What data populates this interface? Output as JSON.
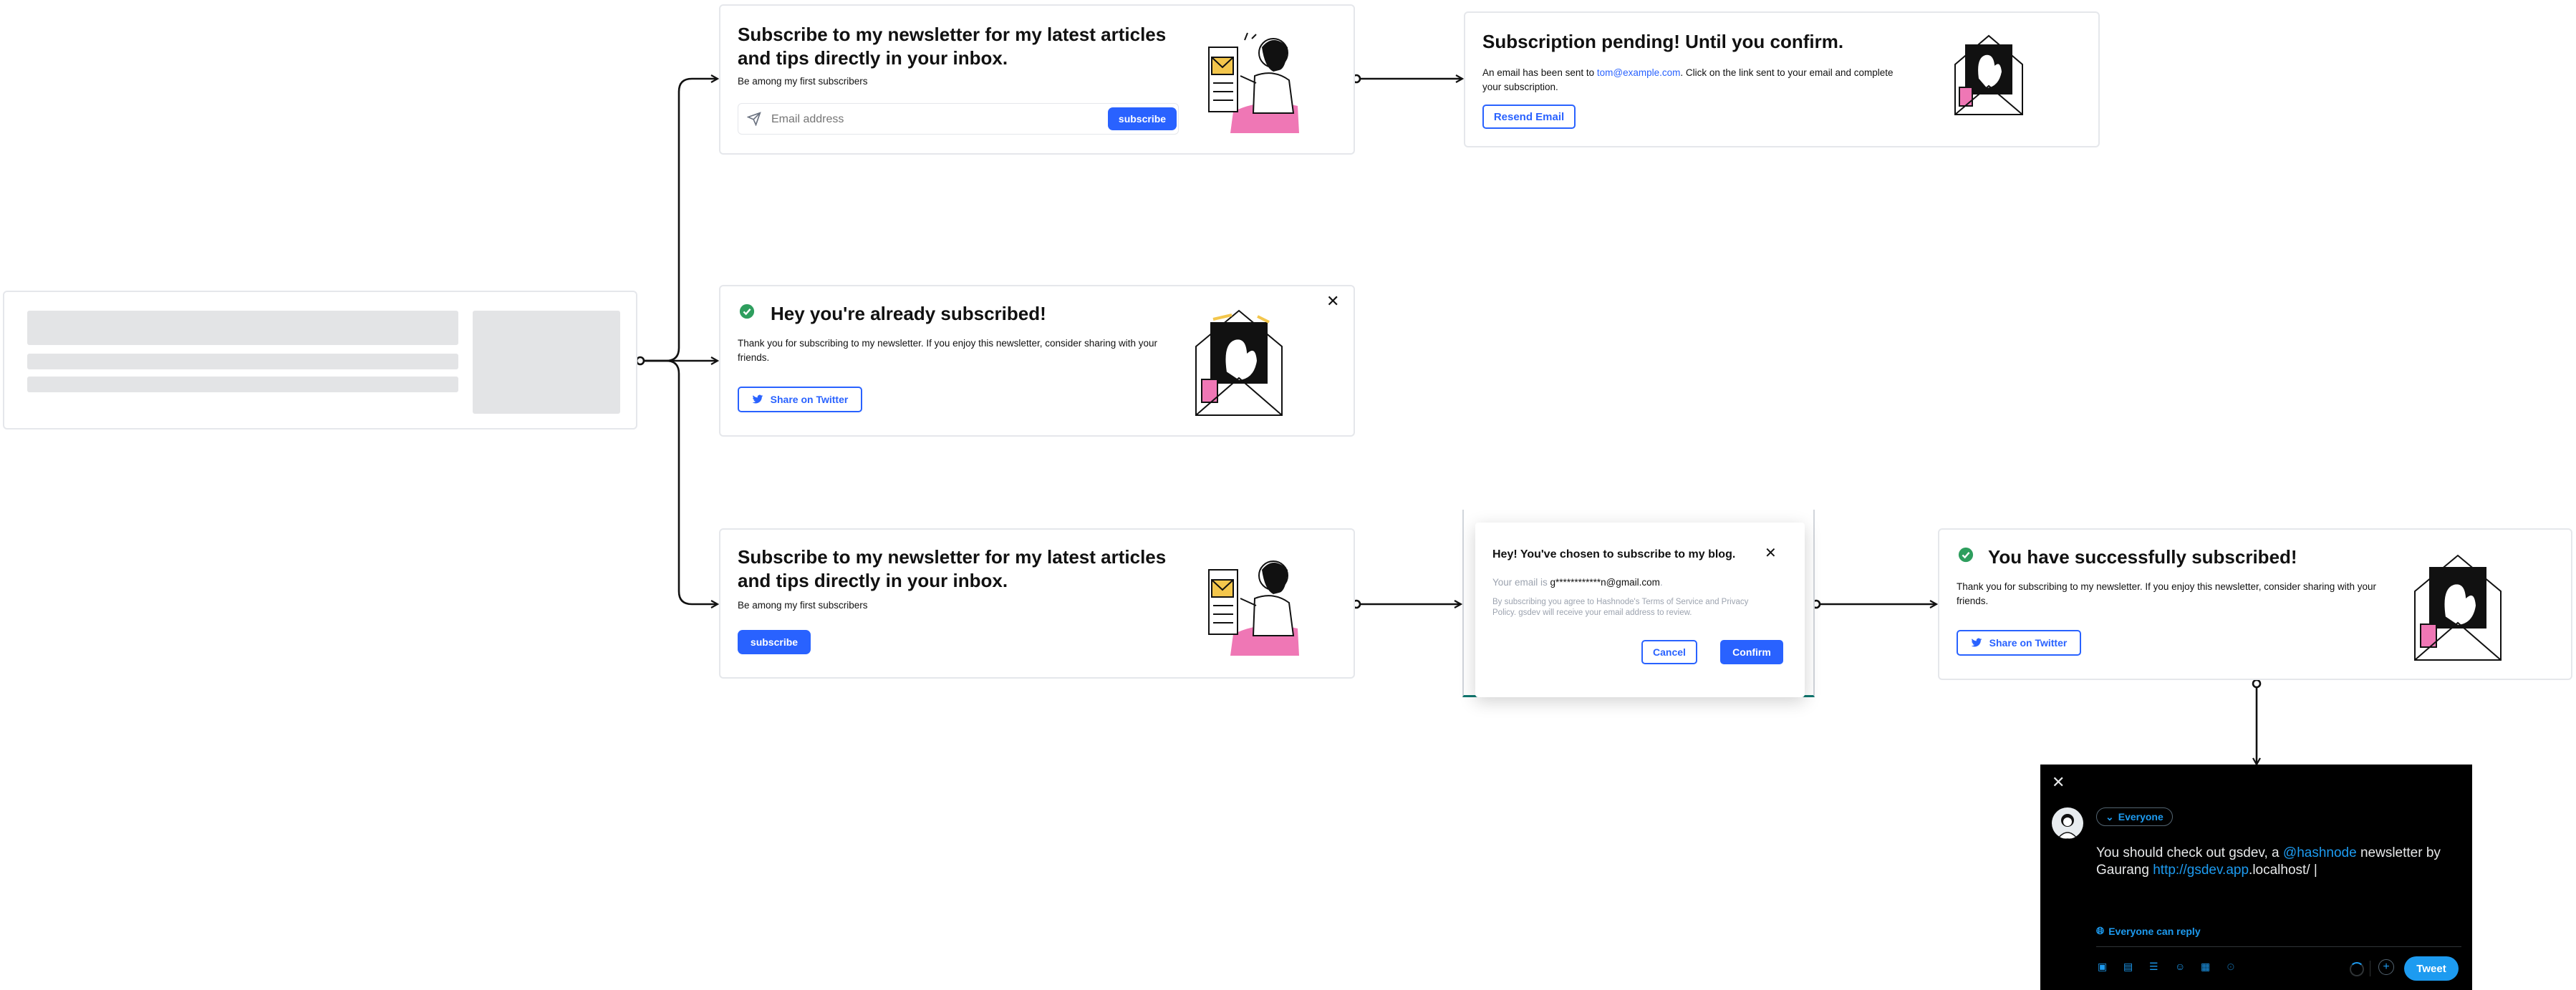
{
  "subscribe_card": {
    "title": "Subscribe to my newsletter for my latest articles and tips directly in your inbox.",
    "subtitle": "Be among my first subscribers",
    "email_placeholder": "Email address",
    "button": "subscribe"
  },
  "pending_card": {
    "title": "Subscription pending! Until you confirm.",
    "text_before": "An email has been sent to ",
    "email": "tom@example.com",
    "text_after": ". Click on the link sent to your email and complete your subscription.",
    "button": "Resend Email"
  },
  "already_card": {
    "title": "Hey you're already subscribed!",
    "text": "Thank you for subscribing to my newsletter. If you enjoy this newsletter, consider sharing with your friends.",
    "button": "Share on Twitter"
  },
  "subscribe_card_2": {
    "title": "Subscribe to my newsletter for my latest articles and tips directly in your inbox.",
    "subtitle": "Be among my first subscribers",
    "button": "subscribe"
  },
  "modal": {
    "title": "Hey! You've chosen to subscribe to my blog.",
    "email_label": "Your email is ",
    "email": "g************n@gmail.com",
    "email_end": ".",
    "legal": "By subscribing you agree to Hashnode's Terms of Service and Privacy Policy. gsdev will receive your email address to review.",
    "cancel": "Cancel",
    "confirm": "Confirm"
  },
  "success_card": {
    "title": "You have successfully subscribed!",
    "text": "Thank you for subscribing to my newsletter. If you enjoy this newsletter, consider sharing with your friends.",
    "button": "Share on Twitter"
  },
  "tweet": {
    "audience": "Everyone",
    "text_1": "You should check out gsdev, a ",
    "mention": "@hashnode",
    "text_2": " newsletter by Gaurang ",
    "link": "http://gsdev.app",
    "text_3": ".localhost/",
    "reply_setting": "Everyone can reply",
    "button": "Tweet"
  },
  "colors": {
    "accent": "#2962ff",
    "success": "#2e9e5e",
    "twitter_blue": "#1d9bf0",
    "skeleton": "#e3e4e6",
    "border": "#e5e7eb"
  },
  "icons": [
    "paper-plane-icon",
    "check-circle-icon",
    "close-icon",
    "twitter-icon",
    "chevron-down-icon",
    "globe-icon",
    "image-icon",
    "gif-icon",
    "poll-icon",
    "emoji-icon",
    "schedule-icon",
    "location-icon",
    "plus-icon"
  ]
}
